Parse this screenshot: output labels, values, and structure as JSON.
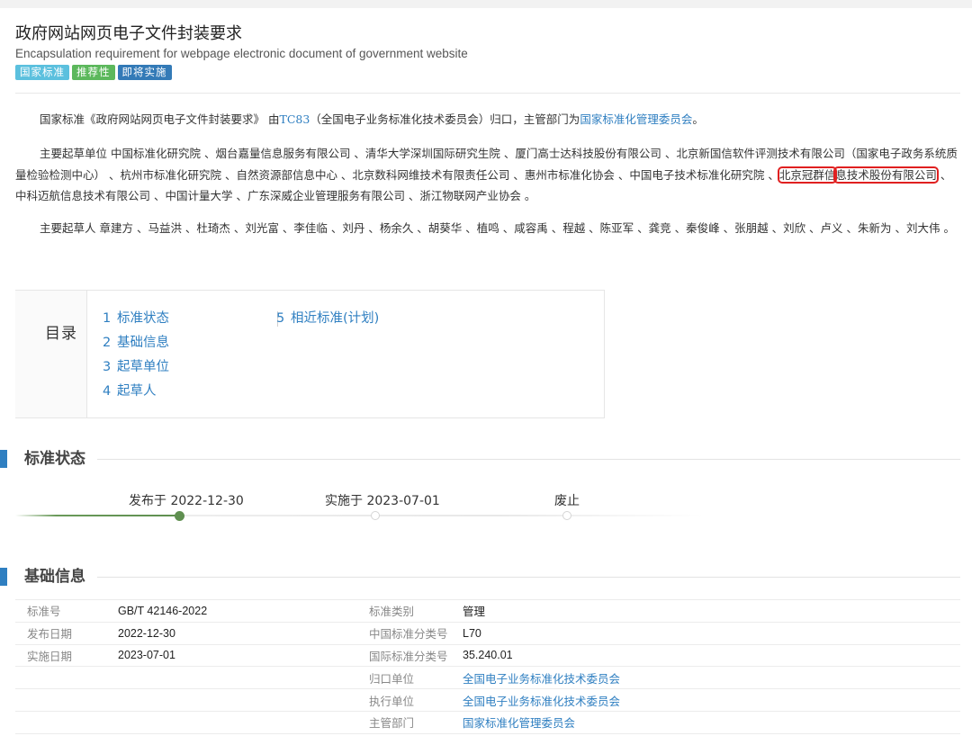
{
  "header": {
    "title": "政府网站网页电子文件封装要求",
    "subtitle": "Encapsulation requirement for webpage electronic document of government website",
    "badges": [
      {
        "label": "国家标准",
        "color": "#5bc0de"
      },
      {
        "label": "推荐性",
        "color": "#5cb85c"
      },
      {
        "label": "即将实施",
        "color": "#337ab7"
      }
    ]
  },
  "intro": {
    "p1_prefix": "国家标准《政府网站网页电子文件封装要求》 由",
    "p1_tc_link": "TC83",
    "p1_middle": "（全国电子业务标准化技术委员会）归口，主管部门为",
    "p1_dept_link": "国家标准化管理委员会",
    "p1_suffix": "。",
    "p2_before": "主要起草单位 中国标准化研究院 、烟台嘉量信息服务有限公司 、清华大学深圳国际研究生院 、厦门高士达科技股份有限公司 、北京新国信软件评测技术有限公司（国家电子政务系统质量检验检测中心） 、杭州市标准化研究院 、自然资源部信息中心 、北京数科网维技术有限责任公司 、惠州市标准化协会 、中国电子技术标准化研究院 、",
    "p2_highlight_a": "北京冠群信",
    "p2_highlight_b": "息技术股份有限公司",
    "p2_after": " 、中科迈航信息技术有限公司 、中国计量大学 、广东深威企业管理服务有限公司 、浙江物联网产业协会 。",
    "p3": "主要起草人 章建方 、马益洪 、杜琦杰 、刘光富 、李佳临 、刘丹 、杨余久 、胡葵华 、植鸣 、咸容禹 、程越 、陈亚军 、龚竞 、秦俊峰 、张朋越 、刘欣 、卢义 、朱新为 、刘大伟 。"
  },
  "toc": {
    "title": "目录",
    "col1": [
      {
        "num": "1",
        "label": "标准状态"
      },
      {
        "num": "2",
        "label": "基础信息"
      },
      {
        "num": "3",
        "label": "起草单位"
      },
      {
        "num": "4",
        "label": "起草人"
      }
    ],
    "col2": [
      {
        "num": "5",
        "label": "相近标准(计划)"
      }
    ]
  },
  "status": {
    "section_title": "标准状态",
    "published": "发布于 2022-12-30",
    "effective": "实施于 2023-07-01",
    "abolished": "废止",
    "done_color": "#5f8f50"
  },
  "basic": {
    "section_title": "基础信息",
    "rows": [
      {
        "l1": "标准号",
        "v1": "GB/T 42146-2022",
        "l2": "标准类别",
        "v2": "管理",
        "v2_link": false
      },
      {
        "l1": "发布日期",
        "v1": "2022-12-30",
        "l2": "中国标准分类号",
        "v2": "L70",
        "v2_link": false
      },
      {
        "l1": "实施日期",
        "v1": "2023-07-01",
        "l2": "国际标准分类号",
        "v2": "35.240.01",
        "v2_link": false
      },
      {
        "l1": "",
        "v1": "",
        "l2": "归口单位",
        "v2": "全国电子业务标准化技术委员会",
        "v2_link": true
      },
      {
        "l1": "",
        "v1": "",
        "l2": "执行单位",
        "v2": "全国电子业务标准化技术委员会",
        "v2_link": true
      },
      {
        "l1": "",
        "v1": "",
        "l2": "主管部门",
        "v2": "国家标准化管理委员会",
        "v2_link": true
      }
    ]
  },
  "colors": {
    "accent": "#2f7fc1",
    "highlight_box": "#e02020"
  }
}
